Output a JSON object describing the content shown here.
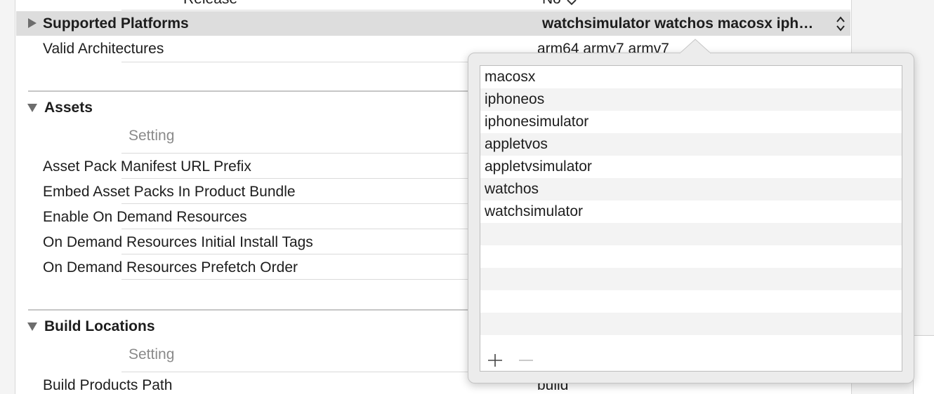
{
  "top_row": {
    "name": "Release",
    "value": "No"
  },
  "supported_platforms": {
    "name": "Supported Platforms",
    "value": "watchsimulator watchos macosx iph…"
  },
  "valid_architectures": {
    "name": "Valid Architectures",
    "value": "arm64 armv7 armv7"
  },
  "assets_section": {
    "title": "Assets",
    "column_header": "Setting",
    "rows": [
      "Asset Pack Manifest URL Prefix",
      "Embed Asset Packs In Product Bundle",
      "Enable On Demand Resources",
      "On Demand Resources Initial Install Tags",
      "On Demand Resources Prefetch Order"
    ]
  },
  "build_locations_section": {
    "title": "Build Locations",
    "column_header": "Setting",
    "rows": [
      {
        "name": "Build Products Path",
        "value": "build"
      }
    ]
  },
  "platforms_popover": {
    "items": [
      "macosx",
      "iphoneos",
      "iphonesimulator",
      "appletvos",
      "appletvsimulator",
      "watchos",
      "watchsimulator"
    ],
    "add_button": "+",
    "remove_button": "−"
  },
  "icons": {
    "disclosure_collapsed": "triangle-right-icon",
    "disclosure_expanded": "triangle-down-icon",
    "stepper": "up-down-chevron-icon",
    "dropdown": "chevron-down-icon"
  }
}
